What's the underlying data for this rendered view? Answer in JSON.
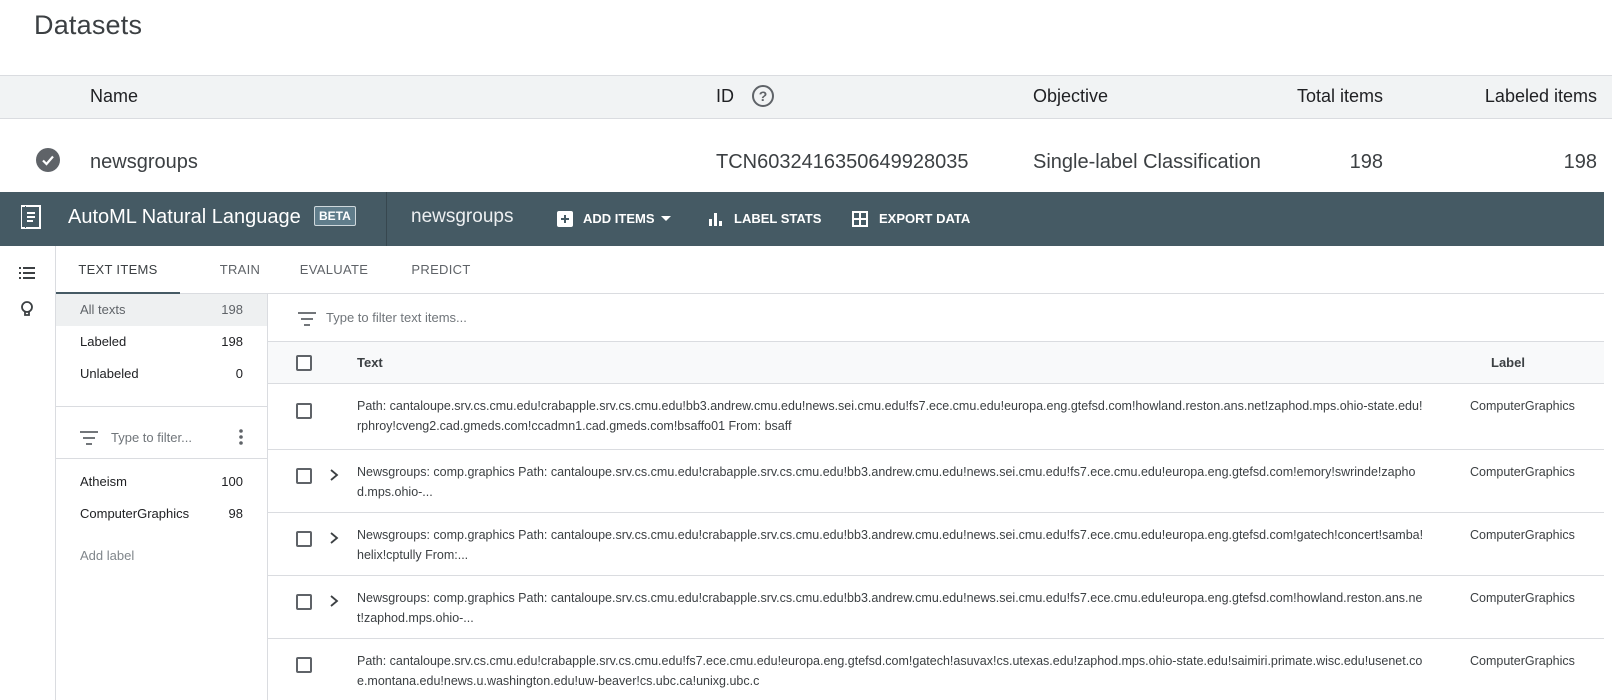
{
  "datasets": {
    "title": "Datasets",
    "columns": {
      "name": "Name",
      "id": "ID",
      "objective": "Objective",
      "total": "Total items",
      "labeled": "Labeled items"
    },
    "row": {
      "name": "newsgroups",
      "id": "TCN603241635064992803​5",
      "objective": "Single-label Classification",
      "total": "198",
      "labeled": "198"
    }
  },
  "appbar": {
    "title": "AutoML Natural Language",
    "badge": "BETA",
    "dataset": "newsgroups",
    "add_items": "ADD ITEMS",
    "label_stats": "LABEL STATS",
    "export_data": "EXPORT DATA",
    "bg_color": "#455a64"
  },
  "tabs": [
    "TEXT ITEMS",
    "TRAIN",
    "EVALUATE",
    "PREDICT"
  ],
  "panel": {
    "all": {
      "label": "All texts",
      "count": "198"
    },
    "labeled": {
      "label": "Labeled",
      "count": "198"
    },
    "unlabeled": {
      "label": "Unlabeled",
      "count": "0"
    },
    "filter_placeholder": "Type to filter...",
    "labels": [
      {
        "label": "Atheism",
        "count": "100"
      },
      {
        "label": "ComputerGraphics",
        "count": "98"
      }
    ],
    "add_label": "Add label"
  },
  "main": {
    "filter_placeholder": "Type to filter text items...",
    "col_text": "Text",
    "col_label": "Label",
    "rows": [
      {
        "text": "Path: cantaloupe.srv.cs.cmu.edu!crabapple.srv.cs.cmu.edu!bb3.andrew.cmu.edu!news.sei.cmu.edu!fs7.ece.cmu.edu!europa.eng.gtefsd.com!howland.reston.ans.net!zaphod.mps.ohio-state.edu!rphroy!cveng2.cad.gmeds.com!ccadmn1.cad.gmeds.com!bsaffo01 From: bsaff",
        "label": "ComputerGraphics"
      },
      {
        "text": "Newsgroups: comp.graphics Path: cantaloupe.srv.cs.cmu.edu!crabapple.srv.cs.cmu.edu!bb3.andrew.cmu.edu!news.sei.cmu.edu!fs7.ece.cmu.edu!europa.eng.gtefsd.com!emory!swrinde!zaphod.mps.ohio-...",
        "label": "ComputerGraphics"
      },
      {
        "text": "Newsgroups: comp.graphics Path: cantaloupe.srv.cs.cmu.edu!crabapple.srv.cs.cmu.edu!bb3.andrew.cmu.edu!news.sei.cmu.edu!fs7.ece.cmu.edu!europa.eng.gtefsd.com!gatech!concert!samba!helix!cptully From:...",
        "label": "ComputerGraphics"
      },
      {
        "text": "Newsgroups: comp.graphics Path: cantaloupe.srv.cs.cmu.edu!crabapple.srv.cs.cmu.edu!bb3.andrew.cmu.edu!news.sei.cmu.edu!fs7.ece.cmu.edu!europa.eng.gtefsd.com!howland.reston.ans.net!zaphod.mps.ohio-...",
        "label": "ComputerGraphics"
      },
      {
        "text": "Path: cantaloupe.srv.cs.cmu.edu!crabapple.srv.cs.cmu.edu!fs7.ece.cmu.edu!europa.eng.gtefsd.com!gatech!asuvax!cs.utexas.edu!zaphod.mps.ohio-state.edu!saimiri.primate.wisc.edu!usenet.coe.montana.edu!news.u.washington.edu!uw-beaver!cs.ubc.ca!unixg.ubc.c",
        "label": "ComputerGraphics"
      }
    ]
  }
}
